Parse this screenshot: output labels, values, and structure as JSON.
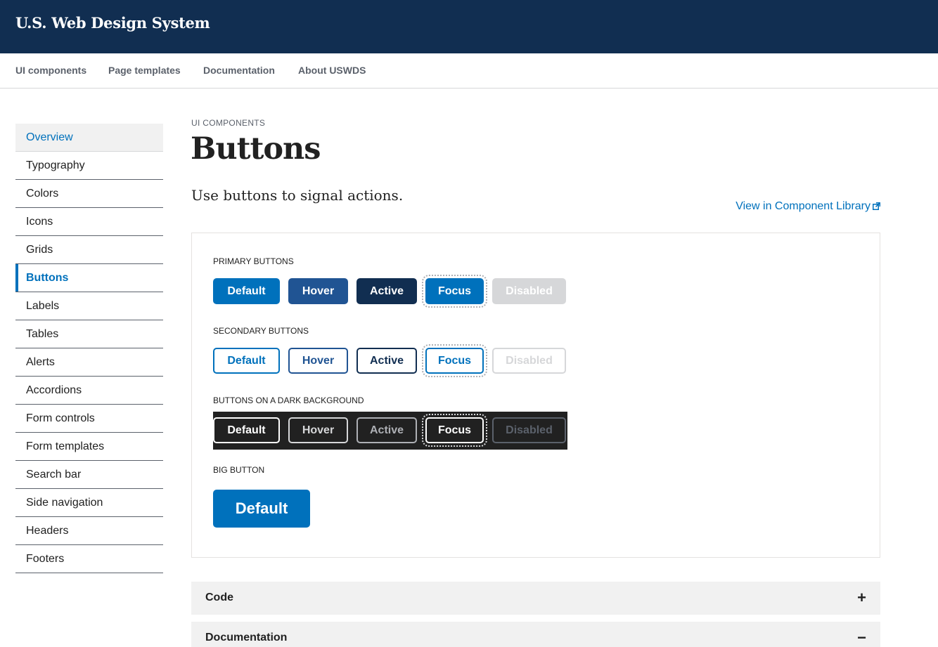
{
  "header": {
    "site_title": "U.S. Web Design System"
  },
  "nav": {
    "items": [
      {
        "label": "UI components"
      },
      {
        "label": "Page templates"
      },
      {
        "label": "Documentation"
      },
      {
        "label": "About USWDS"
      }
    ]
  },
  "sidenav": {
    "items": [
      {
        "label": "Overview"
      },
      {
        "label": "Typography"
      },
      {
        "label": "Colors"
      },
      {
        "label": "Icons"
      },
      {
        "label": "Grids"
      },
      {
        "label": "Buttons"
      },
      {
        "label": "Labels"
      },
      {
        "label": "Tables"
      },
      {
        "label": "Alerts"
      },
      {
        "label": "Accordions"
      },
      {
        "label": "Form controls"
      },
      {
        "label": "Form templates"
      },
      {
        "label": "Search bar"
      },
      {
        "label": "Side navigation"
      },
      {
        "label": "Headers"
      },
      {
        "label": "Footers"
      }
    ],
    "current": "Buttons"
  },
  "main": {
    "eyebrow": "UI COMPONENTS",
    "title": "Buttons",
    "lead": "Use buttons to signal actions.",
    "library_link": "View in Component Library",
    "library_link_icon": "external-link-icon"
  },
  "preview": {
    "primary": {
      "label": "PRIMARY BUTTONS",
      "buttons": [
        "Default",
        "Hover",
        "Active",
        "Focus",
        "Disabled"
      ]
    },
    "secondary": {
      "label": "SECONDARY BUTTONS",
      "buttons": [
        "Default",
        "Hover",
        "Active",
        "Focus",
        "Disabled"
      ]
    },
    "dark": {
      "label": "BUTTONS ON A DARK BACKGROUND",
      "buttons": [
        "Default",
        "Hover",
        "Active",
        "Focus",
        "Disabled"
      ]
    },
    "big": {
      "label": "BIG BUTTON",
      "button": "Default"
    }
  },
  "accordions": [
    {
      "title": "Code",
      "icon": "+",
      "icon_name": "plus-icon"
    },
    {
      "title": "Documentation",
      "icon": "−",
      "icon_name": "minus-icon"
    }
  ],
  "colors": {
    "header_bg": "#112e51",
    "primary": "#0071bc",
    "primary_darker": "#205493",
    "primary_darkest": "#112e51",
    "disabled": "#d6d7d9",
    "dark_bg": "#212121"
  }
}
